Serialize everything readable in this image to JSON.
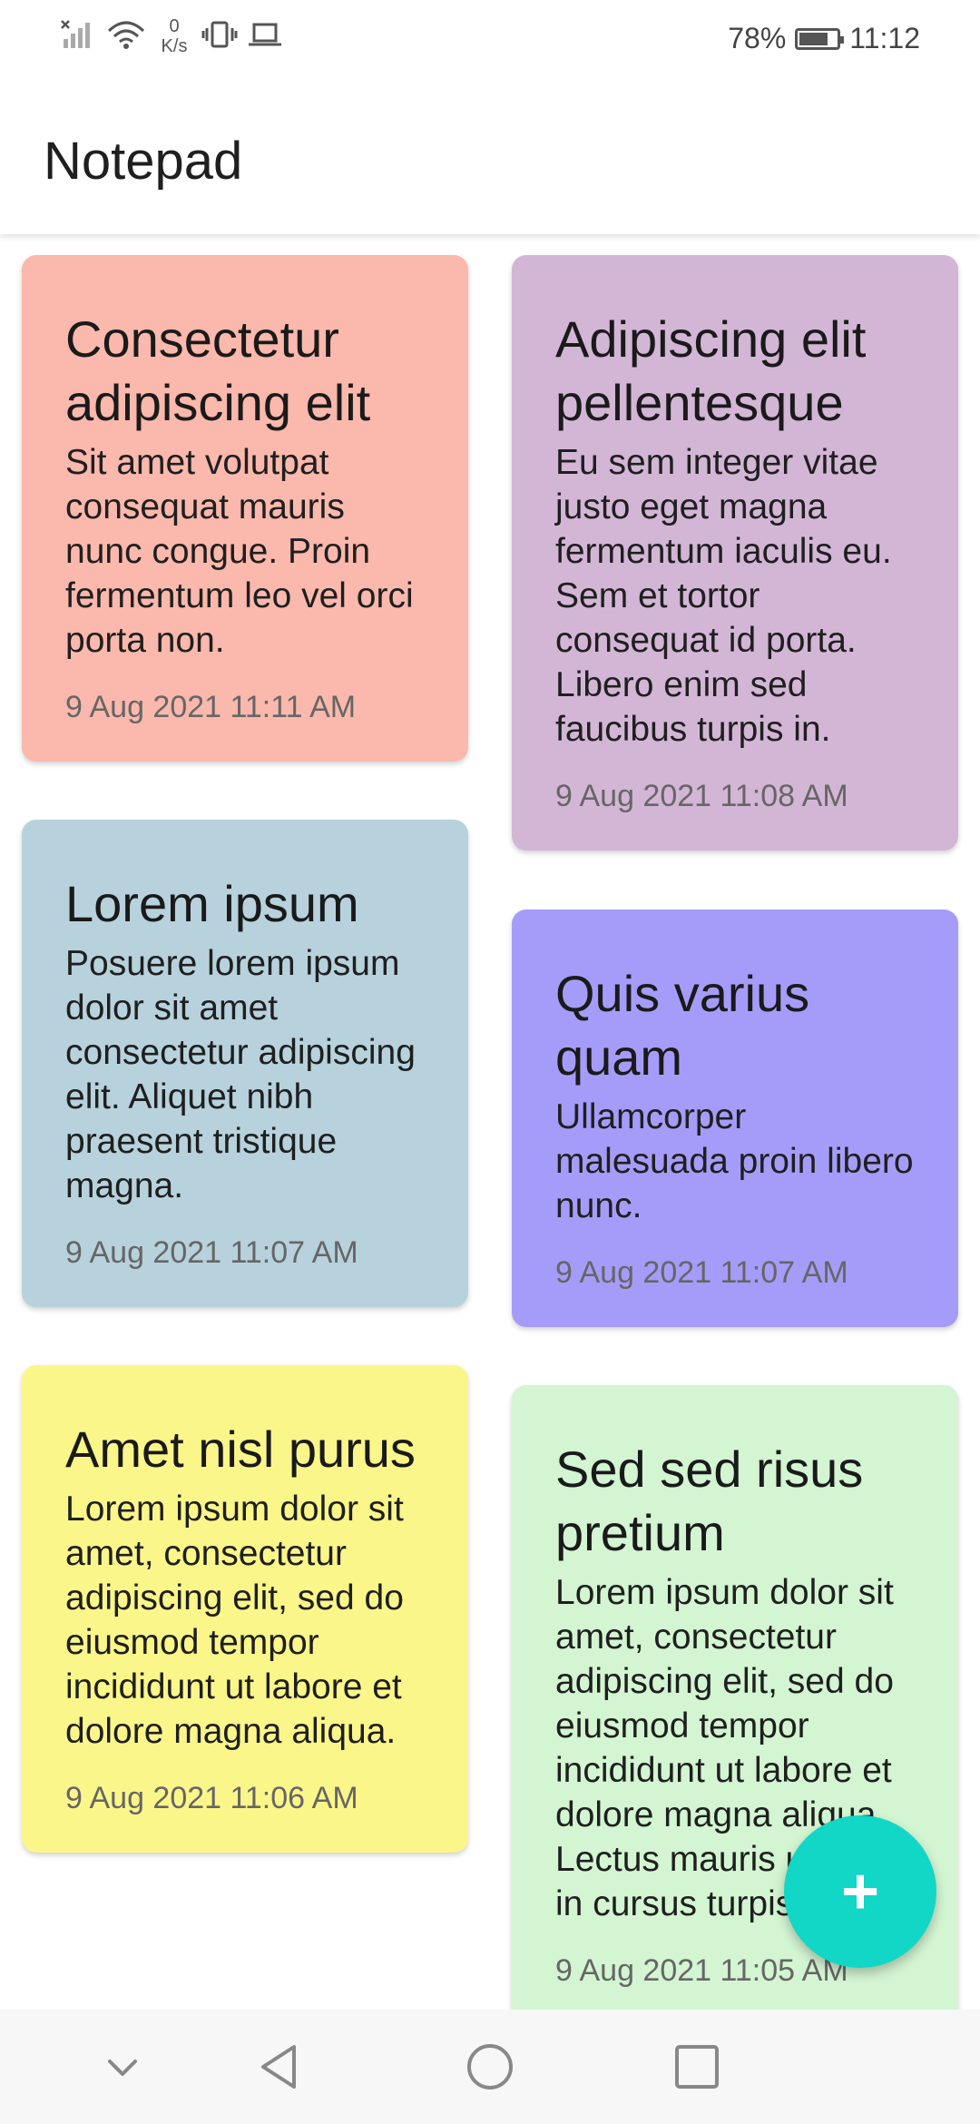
{
  "status_bar": {
    "speed_value": "0",
    "speed_unit": "K/s",
    "battery_percent": "78%",
    "time": "11:12"
  },
  "app_bar": {
    "title": "Notepad"
  },
  "notes": [
    {
      "title": "Consectetur adipiscing elit",
      "body": "Sit amet volutpat consequat mauris nunc congue. Proin fermentum leo vel orci porta non.",
      "date": "9 Aug 2021 11:11 AM",
      "color": "#fbb8ac"
    },
    {
      "title": "Adipiscing elit pellentesque",
      "body": "Eu sem integer vitae justo eget magna fermentum iaculis eu. Sem et tortor consequat id porta. Libero enim sed faucibus turpis in.",
      "date": "9 Aug 2021 11:08 AM",
      "color": "#d3b6d6"
    },
    {
      "title": "Lorem ipsum",
      "body": "Posuere lorem ipsum dolor sit amet consectetur adipiscing elit. Aliquet nibh praesent tristique magna.",
      "date": "9 Aug 2021 11:07 AM",
      "color": "#b7d2dc"
    },
    {
      "title": "Quis varius quam",
      "body": "Ullamcorper malesuada proin libero nunc.",
      "date": "9 Aug 2021 11:07 AM",
      "color": "#a59cfa"
    },
    {
      "title": "Amet nisl purus",
      "body": "Lorem ipsum dolor sit amet, consectetur adipiscing elit, sed do eiusmod tempor incididunt ut labore et dolore magna aliqua.",
      "date": "9 Aug 2021 11:06 AM",
      "color": "#fbf68a"
    },
    {
      "title": "Sed sed risus pretium",
      "body": "Lorem ipsum dolor sit amet, consectetur adipiscing elit, sed do eiusmod tempor incididunt ut labore et dolore magna aliqua. Lectus mauris ultrices in cursus turpis.",
      "date": "9 Aug 2021 11:05 AM",
      "color": "#d3f5d2"
    }
  ],
  "fab": {
    "label": "+"
  },
  "icons": {
    "signal": "signal-icon",
    "wifi": "wifi-icon",
    "vibrate": "vibrate-icon",
    "laptop": "laptop-icon",
    "battery": "battery-icon",
    "add": "add-icon",
    "nav_down": "chevron-down-icon",
    "nav_back": "back-icon",
    "nav_home": "home-icon",
    "nav_recents": "recents-icon"
  }
}
